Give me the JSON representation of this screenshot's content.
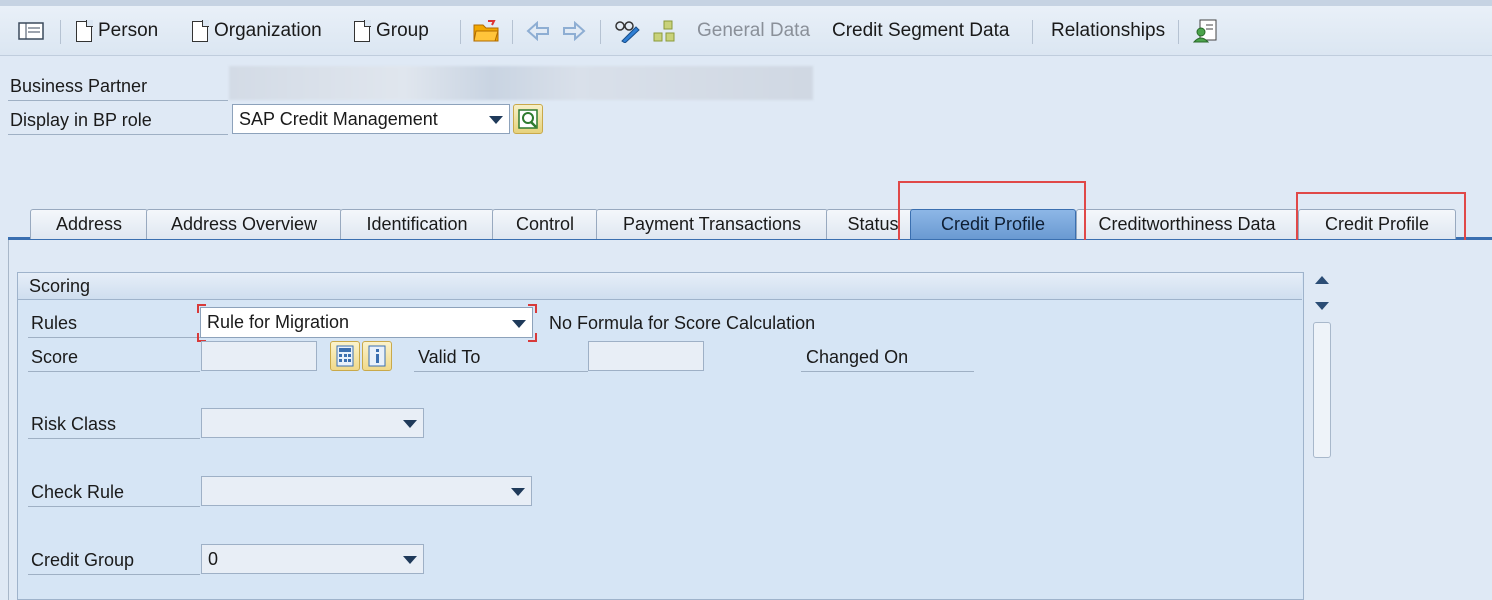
{
  "toolbar": {
    "person_label": "Person",
    "organization_label": "Organization",
    "group_label": "Group",
    "general_data_label": "General Data",
    "credit_segment_label": "Credit Segment Data",
    "relationships_label": "Relationships"
  },
  "header": {
    "business_partner_label": "Business Partner",
    "bp_role_label": "Display in BP role",
    "bp_role_value": "SAP Credit Management"
  },
  "tabs": [
    {
      "label": "Address"
    },
    {
      "label": "Address Overview"
    },
    {
      "label": "Identification"
    },
    {
      "label": "Control"
    },
    {
      "label": "Payment Transactions"
    },
    {
      "label": "Status"
    },
    {
      "label": "Credit Profile"
    },
    {
      "label": "Creditworthiness Data"
    },
    {
      "label": "Credit Profile"
    }
  ],
  "scoring": {
    "title": "Scoring",
    "rules_label": "Rules",
    "rules_value": "Rule for Migration",
    "formula_text": "No Formula for Score Calculation",
    "score_label": "Score",
    "valid_to_label": "Valid To",
    "changed_on_label": "Changed On",
    "risk_class_label": "Risk Class",
    "check_rule_label": "Check Rule",
    "credit_group_label": "Credit Group",
    "credit_group_value": "0"
  },
  "colors": {
    "accent": "#3a6fb0",
    "highlight": "#e04848"
  }
}
